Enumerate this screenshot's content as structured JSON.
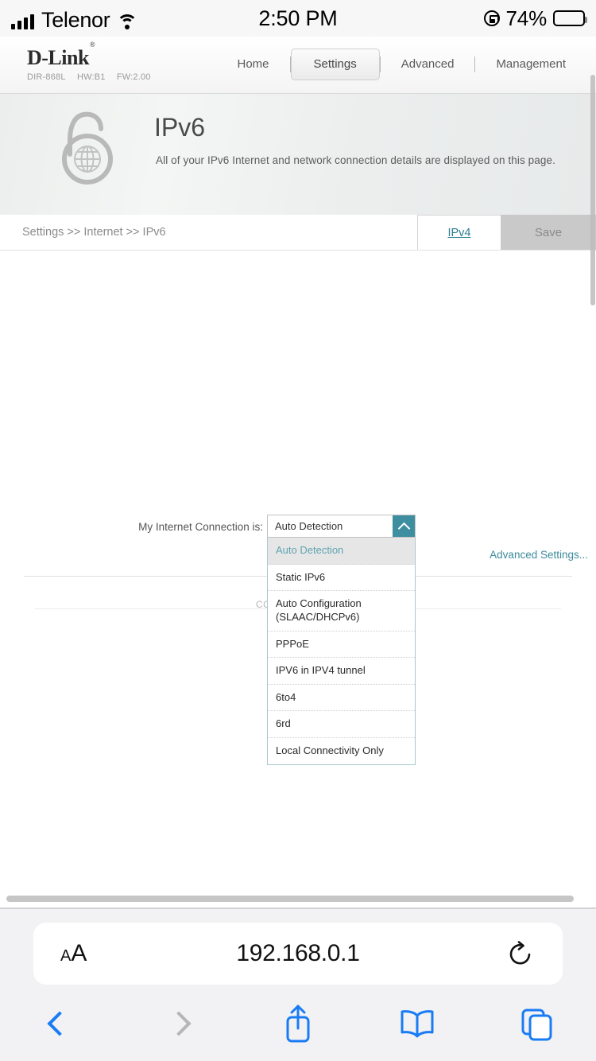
{
  "statusbar": {
    "carrier": "Telenor",
    "time": "2:50 PM",
    "battery_percent": "74%",
    "signal_icon": "cellular-bars-icon",
    "wifi_icon": "wifi-icon",
    "rotation_lock_icon": "rotation-lock-icon",
    "battery_icon": "battery-icon"
  },
  "router": {
    "brand": "D-Link",
    "brand_mark": "®",
    "model": "DIR-868L",
    "hardware": "HW:B1",
    "firmware": "FW:2.00",
    "nav": [
      {
        "label": "Home",
        "active": false
      },
      {
        "label": "Settings",
        "active": true
      },
      {
        "label": "Advanced",
        "active": false
      },
      {
        "label": "Management",
        "active": false
      }
    ]
  },
  "banner": {
    "title": "IPv6",
    "subtitle": "All of your IPv6 Internet and network connection details are displayed on this page.",
    "icon": "ipv6-lock-globe-icon"
  },
  "toolbar": {
    "breadcrumb": "Settings >> Internet >> IPv6",
    "ipv4_label": "IPv4",
    "save_label": "Save"
  },
  "form": {
    "connection_label": "My Internet Connection is:",
    "advanced_settings_label": "Advanced Settings...",
    "obscured_text": "CO",
    "dropdown": {
      "value": "Auto Detection",
      "expanded": true,
      "arrow_icon": "chevron-up-icon",
      "options": [
        {
          "label": "Auto Detection",
          "selected": true
        },
        {
          "label": "Static IPv6",
          "selected": false
        },
        {
          "label": "Auto Configuration (SLAAC/DHCPv6)",
          "selected": false
        },
        {
          "label": "PPPoE",
          "selected": false
        },
        {
          "label": "IPV6 in IPV4 tunnel",
          "selected": false
        },
        {
          "label": "6to4",
          "selected": false
        },
        {
          "label": "6rd",
          "selected": false
        },
        {
          "label": "Local Connectivity Only",
          "selected": false
        }
      ]
    }
  },
  "safari": {
    "text_size_small": "A",
    "text_size_large": "A",
    "url": "192.168.0.1",
    "reload_icon": "reload-icon",
    "back_icon": "chevron-left-icon",
    "forward_icon": "chevron-right-icon",
    "share_icon": "share-icon",
    "bookmarks_icon": "book-icon",
    "tabs_icon": "tabs-icon"
  },
  "colors": {
    "accent_teal": "#3d8fa0",
    "link_teal": "#2f7f91",
    "safari_blue": "#1a7cf5",
    "save_bg": "#c9c9c9"
  }
}
